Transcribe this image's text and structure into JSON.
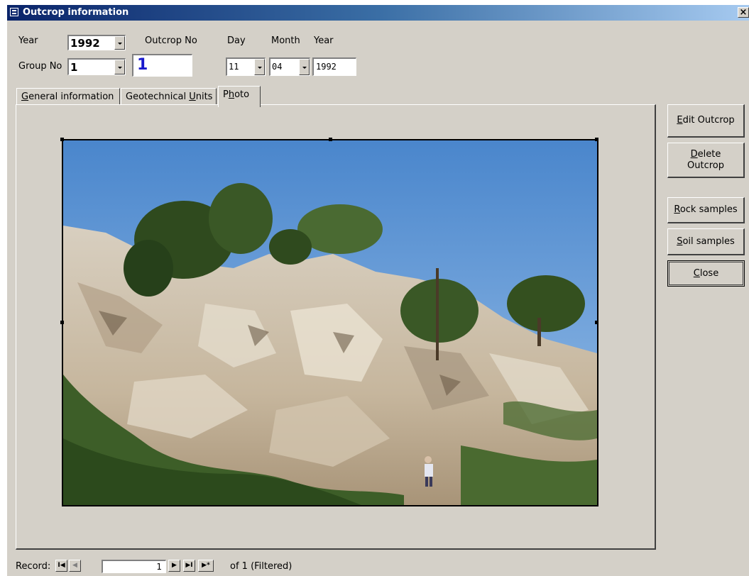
{
  "window": {
    "title": "Outcrop information",
    "close_glyph": "×"
  },
  "header": {
    "year_label": "Year",
    "year_value": "1992",
    "outcrop_no_label": "Outcrop No",
    "outcrop_no_value": "1",
    "group_no_label": "Group No",
    "group_no_value": "1",
    "day_label": "Day",
    "month_label": "Month",
    "year2_label": "Year",
    "day_value": "11",
    "month_value": "04",
    "year2_value": "1992"
  },
  "tabs": [
    {
      "label_pre": "",
      "label_key": "G",
      "label_post": "eneral information"
    },
    {
      "label_pre": "Geotechnical ",
      "label_key": "U",
      "label_post": "nits"
    },
    {
      "label_pre": "P",
      "label_key": "h",
      "label_post": "oto"
    }
  ],
  "side_buttons": {
    "edit_key": "E",
    "edit_rest": "dit Outcrop",
    "delete_key": "D",
    "delete_rest": "elete",
    "delete_line2": "Outcrop",
    "rock_key": "R",
    "rock_rest": "ock samples",
    "soil_key": "S",
    "soil_rest": "oil samples",
    "close_key": "C",
    "close_rest": "lose"
  },
  "record_nav": {
    "label": "Record:",
    "current": "1",
    "of_text": "of  1 (Filtered)",
    "first_glyph": "I◀",
    "prev_glyph": "◀",
    "next_glyph": "▶",
    "last_glyph": "▶I",
    "new_glyph": "▶*"
  },
  "colors": {
    "outcrop_no": "#1a1acc",
    "title_bar_start": "#0a246a",
    "title_bar_end": "#a6caf0"
  }
}
